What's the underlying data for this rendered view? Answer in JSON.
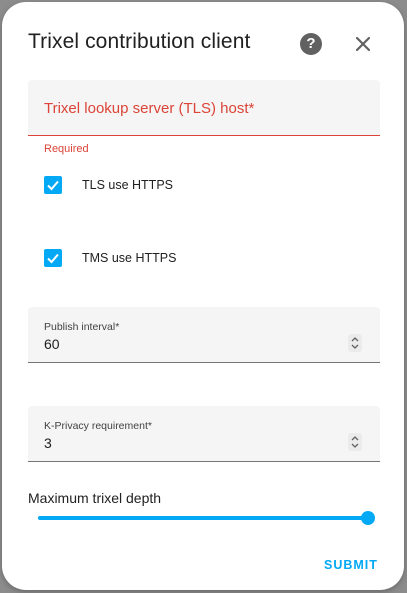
{
  "dialog": {
    "title": "Trixel contribution client",
    "help_icon": "help-circle-icon",
    "close_icon": "close-icon",
    "tls_host": {
      "label": "Trixel lookup server (TLS) host*",
      "value": "",
      "helper_text": "Required"
    },
    "tls_https": {
      "label": "TLS use HTTPS",
      "checked": true
    },
    "tms_https": {
      "label": "TMS use HTTPS",
      "checked": true
    },
    "publish_interval": {
      "label": "Publish interval*",
      "value": "60"
    },
    "k_privacy": {
      "label": "K-Privacy requirement*",
      "value": "3"
    },
    "trixel_depth": {
      "label": "Maximum trixel depth",
      "fraction": 1.0
    },
    "submit_label": "SUBMIT"
  },
  "colors": {
    "accent": "#03a9f4",
    "error": "#db4437",
    "field_bg": "#f5f5f5",
    "backdrop": "#8c8c8c"
  }
}
